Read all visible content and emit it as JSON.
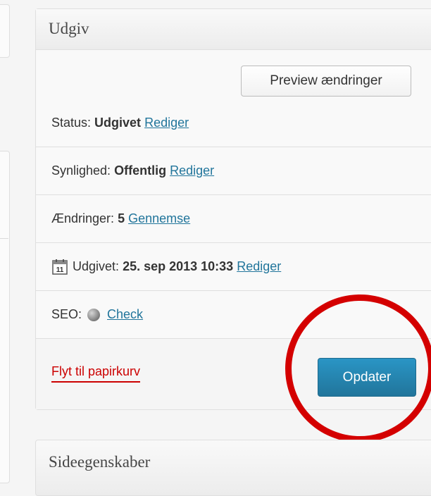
{
  "publish_box": {
    "title": "Udgiv",
    "preview_button": "Preview ændringer",
    "status": {
      "label": "Status:",
      "value": "Udgivet",
      "edit": "Rediger"
    },
    "visibility": {
      "label": "Synlighed:",
      "value": "Offentlig",
      "edit": "Rediger"
    },
    "revisions": {
      "label": "Ændringer:",
      "value": "5",
      "browse": "Gennemse"
    },
    "published": {
      "label": "Udgivet:",
      "value": "25. sep 2013 10:33",
      "edit": "Rediger",
      "calendar_day": "11",
      "icon": "calendar-icon"
    },
    "seo": {
      "label": "SEO:",
      "check": "Check",
      "icon": "seo-status-dot-icon"
    },
    "trash_link": "Flyt til papirkurv",
    "update_button": "Opdater"
  },
  "page_attributes_box": {
    "title": "Sideegenskaber"
  },
  "colors": {
    "link": "#21759b",
    "primary_button": "#21759b",
    "trash": "#cc0000",
    "annotation_circle": "#d40000"
  }
}
